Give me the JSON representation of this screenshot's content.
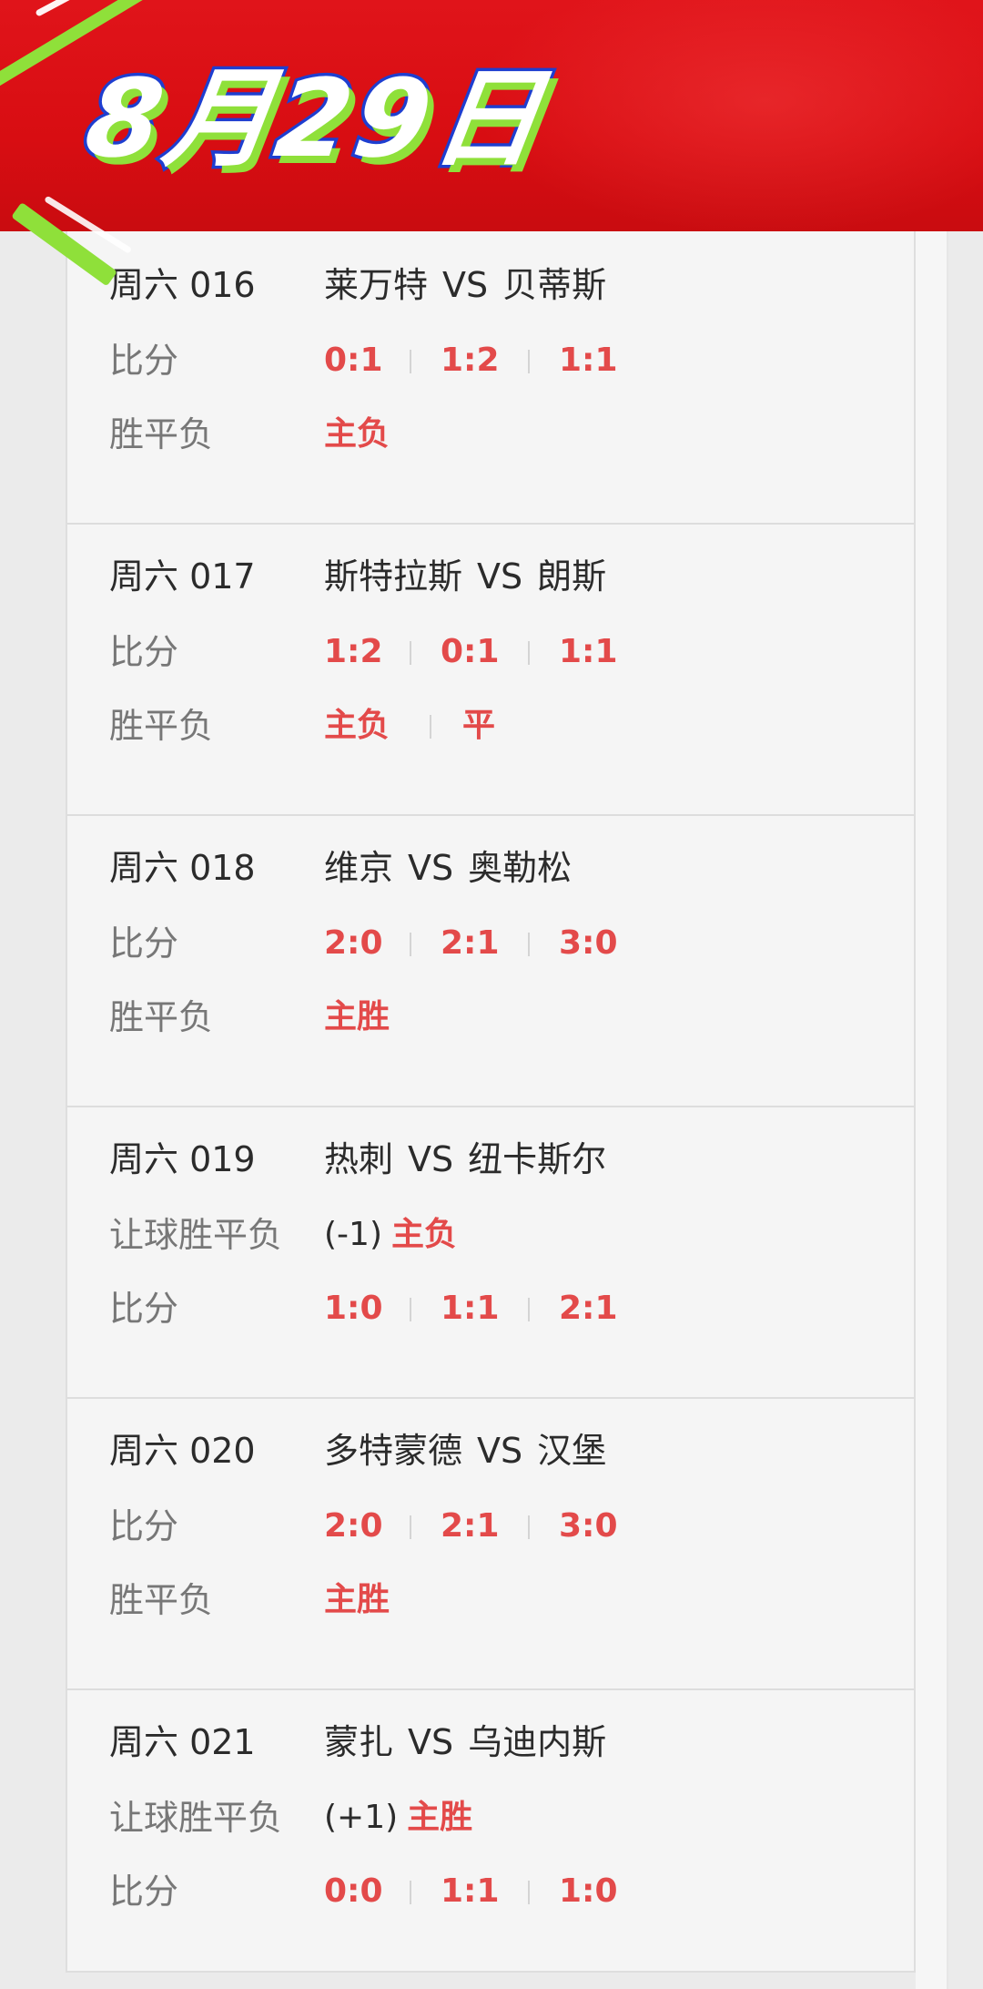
{
  "header": {
    "date_title": "8月29日",
    "colors": {
      "background": "#d80d12",
      "text_outline": "#1f3fd0",
      "accent": "#8fe03a"
    }
  },
  "colors": {
    "highlight": "#e34a4a",
    "label": "#777777",
    "text": "#2b2b2b"
  },
  "matches": [
    {
      "id": "周六 016",
      "home": "莱万特",
      "vs": "VS",
      "away": "贝蒂斯",
      "rows": [
        {
          "label": "比分",
          "values": [
            "0:1",
            "1:2",
            "1:1"
          ]
        },
        {
          "label": "胜平负",
          "values": [
            "主负"
          ]
        }
      ]
    },
    {
      "id": "周六 017",
      "home": "斯特拉斯",
      "vs": "VS",
      "away": "朗斯",
      "rows": [
        {
          "label": "比分",
          "values": [
            "1:2",
            "0:1",
            "1:1"
          ]
        },
        {
          "label": "胜平负",
          "values": [
            "主负",
            "平"
          ]
        }
      ]
    },
    {
      "id": "周六 018",
      "home": "维京",
      "vs": "VS",
      "away": "奥勒松",
      "rows": [
        {
          "label": "比分",
          "values": [
            "2:0",
            "2:1",
            "3:0"
          ]
        },
        {
          "label": "胜平负",
          "values": [
            "主胜"
          ]
        }
      ]
    },
    {
      "id": "周六 019",
      "home": "热刺",
      "vs": "VS",
      "away": "纽卡斯尔",
      "rows": [
        {
          "label": "让球胜平负",
          "prefix": "(-1)",
          "values": [
            "主负"
          ]
        },
        {
          "label": "比分",
          "values": [
            "1:0",
            "1:1",
            "2:1"
          ]
        }
      ]
    },
    {
      "id": "周六 020",
      "home": "多特蒙德",
      "vs": "VS",
      "away": "汉堡",
      "rows": [
        {
          "label": "比分",
          "values": [
            "2:0",
            "2:1",
            "3:0"
          ]
        },
        {
          "label": "胜平负",
          "values": [
            "主胜"
          ]
        }
      ]
    },
    {
      "id": "周六 021",
      "home": "蒙扎",
      "vs": "VS",
      "away": "乌迪内斯",
      "rows": [
        {
          "label": "让球胜平负",
          "prefix": "(+1)",
          "values": [
            "主胜"
          ]
        },
        {
          "label": "比分",
          "values": [
            "0:0",
            "1:1",
            "1:0"
          ]
        }
      ]
    }
  ]
}
